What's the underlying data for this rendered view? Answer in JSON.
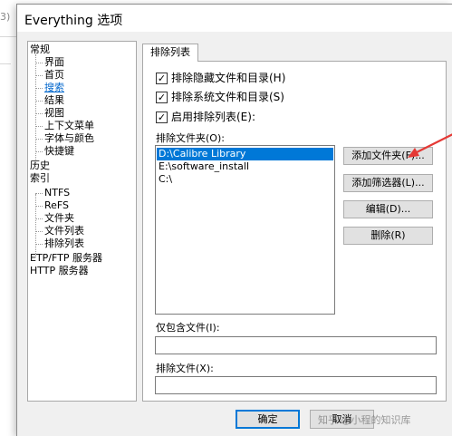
{
  "background": {
    "fragment_text": "3)"
  },
  "window": {
    "title": "Everything 选项"
  },
  "tree": {
    "items": [
      {
        "label": "常规",
        "level": 0
      },
      {
        "label": "界面",
        "level": 1
      },
      {
        "label": "首页",
        "level": 1
      },
      {
        "label": "搜索",
        "level": 1,
        "selected": true
      },
      {
        "label": "结果",
        "level": 1
      },
      {
        "label": "视图",
        "level": 1
      },
      {
        "label": "上下文菜单",
        "level": 1
      },
      {
        "label": "字体与颜色",
        "level": 1
      },
      {
        "label": "快捷键",
        "level": 1
      },
      {
        "label": "历史",
        "level": 0
      },
      {
        "label": "索引",
        "level": 0
      },
      {
        "label": "NTFS",
        "level": 1
      },
      {
        "label": "ReFS",
        "level": 1
      },
      {
        "label": "文件夹",
        "level": 1
      },
      {
        "label": "文件列表",
        "level": 1
      },
      {
        "label": "排除列表",
        "level": 1
      },
      {
        "label": "ETP/FTP 服务器",
        "level": 0
      },
      {
        "label": "HTTP 服务器",
        "level": 0
      }
    ]
  },
  "tab": {
    "label": "排除列表"
  },
  "checkboxes": {
    "exclude_hidden": {
      "label": "排除隐藏文件和目录(H)",
      "checked": true,
      "mark": "✓"
    },
    "exclude_system": {
      "label": "排除系统文件和目录(S)",
      "checked": true,
      "mark": "✓"
    },
    "enable_exclude": {
      "label": "启用排除列表(E):",
      "checked": true,
      "mark": "✓"
    }
  },
  "exclude_folders": {
    "label": "排除文件夹(O):",
    "items": [
      "D:\\Calibre Library",
      "E:\\software_install",
      "C:\\"
    ],
    "selected_index": 0
  },
  "buttons": {
    "add_folder": "添加文件夹(F)...",
    "add_filter": "添加筛选器(L)...",
    "edit": "编辑(D)...",
    "delete": "删除(R)"
  },
  "include_only_files": {
    "label": "仅包含文件(I):",
    "value": ""
  },
  "exclude_files": {
    "label": "排除文件(X):",
    "value": ""
  },
  "dialog_buttons": {
    "ok": "确定",
    "cancel": "取消",
    "watermark": "知乎 @小程的知识库"
  },
  "colors": {
    "selection": "#0078d7",
    "selected_link": "#0066cc",
    "arrow": "#e53935"
  }
}
